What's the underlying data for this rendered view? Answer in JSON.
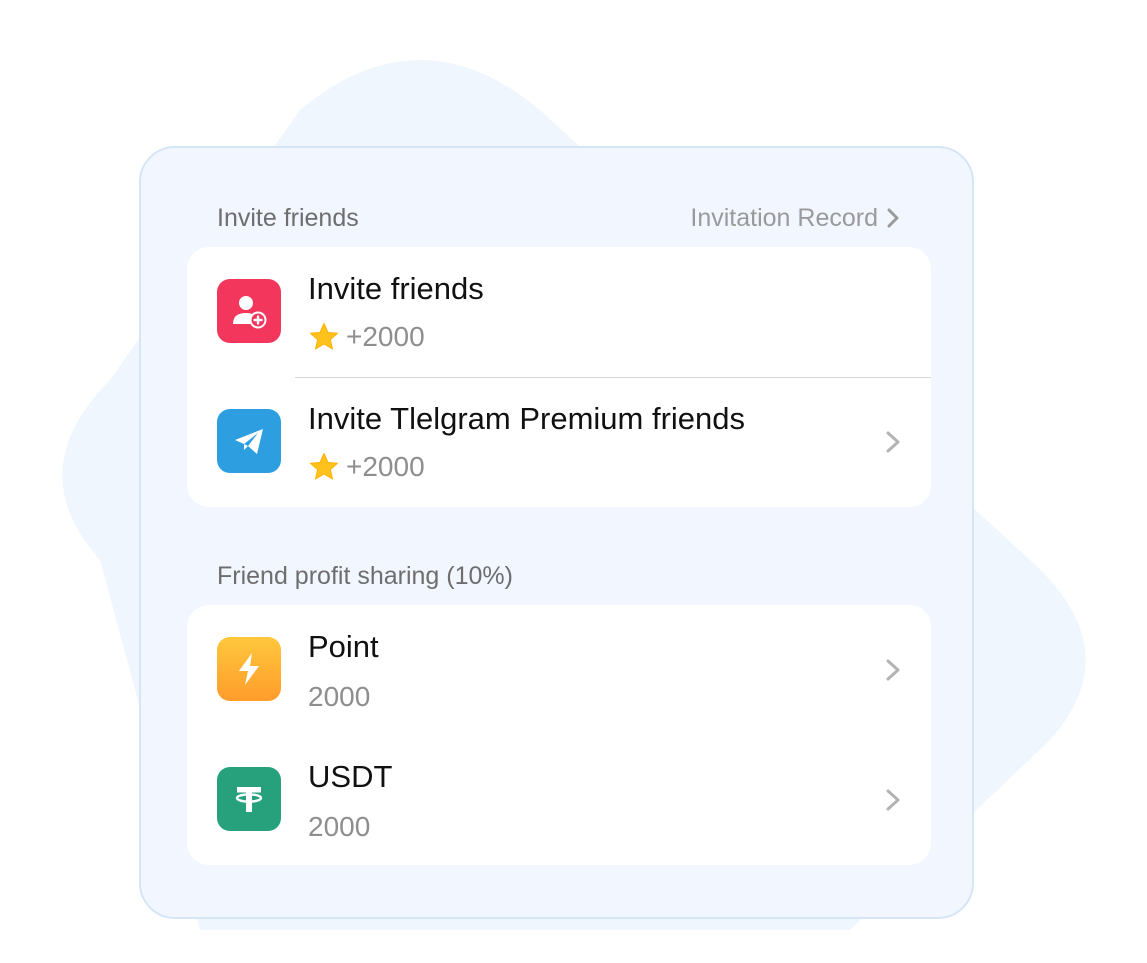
{
  "colors": {
    "panel_bg": "#f2f7ff",
    "panel_border": "#d7e6f7",
    "blob": "#f0f6fd",
    "invite_icon": "#f2365c",
    "telegram_icon": "#2d9fe0",
    "point_icon": "#ffb236",
    "usdt_icon": "#26a17b",
    "star": "#ffc21c"
  },
  "invite_section": {
    "title": "Invite friends",
    "record_link": "Invitation Record",
    "items": [
      {
        "title": "Invite friends",
        "reward": "+2000",
        "icon": "user-add-icon",
        "has_chevron": false
      },
      {
        "title": "Invite Tlelgram Premium friends",
        "reward": "+2000",
        "icon": "telegram-icon",
        "has_chevron": true
      }
    ]
  },
  "profit_section": {
    "title": "Friend profit sharing (10%)",
    "items": [
      {
        "title": "Point",
        "value": "2000",
        "icon": "lightning-icon"
      },
      {
        "title": "USDT",
        "value": "2000",
        "icon": "tether-icon"
      }
    ]
  }
}
